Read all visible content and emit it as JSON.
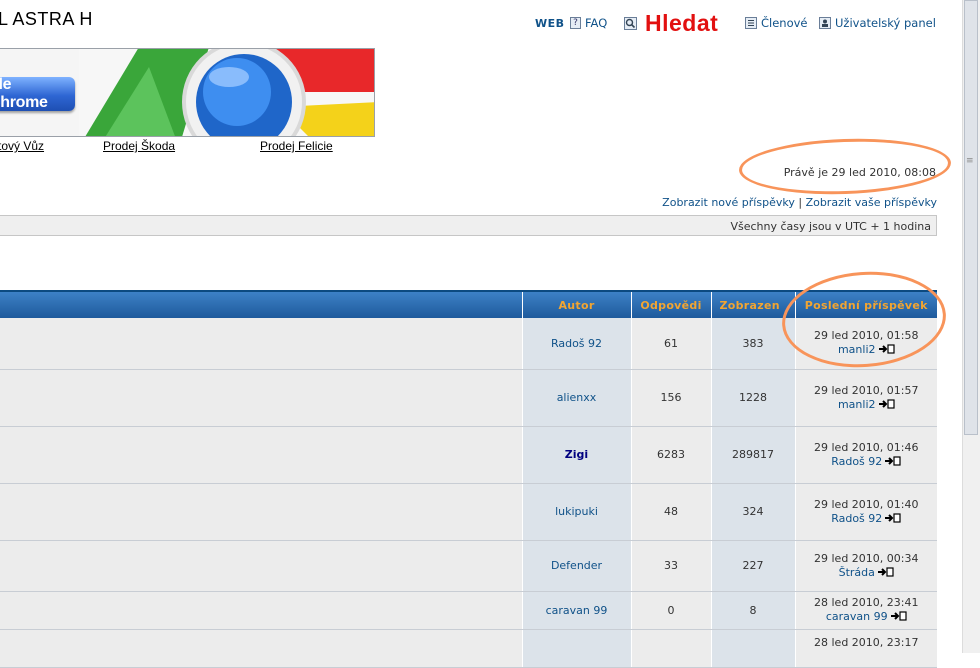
{
  "header": {
    "site_title": "L ASTRA H",
    "nav": {
      "web": "WEB",
      "faq": "FAQ",
      "search": "Hledat",
      "members": "Členové",
      "user_panel": "Uživatelský panel"
    }
  },
  "banner": {
    "button_label": "gle Chrome",
    "links": [
      "tový Vůz",
      "Prodej Škoda",
      "Prodej Felicie"
    ]
  },
  "info": {
    "current_time": "Právě je 29 led 2010, 08:08",
    "new_posts_link": "Zobrazit nové příspěvky",
    "separator": "|",
    "your_posts_link": "Zobrazit vaše příspěvky",
    "timezone": "Všechny časy jsou v UTC + 1 hodina"
  },
  "table": {
    "headers": {
      "author": "Autor",
      "replies": "Odpovědi",
      "views": "Zobrazen",
      "last_post": "Poslední příspěvek"
    },
    "rows": [
      {
        "author": "Radoš 92",
        "replies": "61",
        "views": "383",
        "last_date": "29 led 2010, 01:58",
        "last_user": "manli2"
      },
      {
        "author": "alienxx",
        "replies": "156",
        "views": "1228",
        "last_date": "29 led 2010, 01:57",
        "last_user": "manli2"
      },
      {
        "author": "Zigi",
        "replies": "6283",
        "views": "289817",
        "last_date": "29 led 2010, 01:46",
        "last_user": "Radoš 92"
      },
      {
        "author": "lukipuki",
        "replies": "48",
        "views": "324",
        "last_date": "29 led 2010, 01:40",
        "last_user": "Radoš 92"
      },
      {
        "author": "Defender",
        "replies": "33",
        "views": "227",
        "last_date": "29 led 2010, 00:34",
        "last_user": "Štráda"
      },
      {
        "author": "caravan 99",
        "replies": "0",
        "views": "8",
        "last_date": "28 led 2010, 23:41",
        "last_user": "caravan 99"
      },
      {
        "author": "",
        "replies": "",
        "views": "",
        "last_date": "28 led 2010, 23:17",
        "last_user": ""
      }
    ]
  },
  "colors": {
    "header_bg": "#1e5a9c",
    "header_text": "#f2a531",
    "link": "#105289",
    "search": "#e21010",
    "annotation": "#f8945a"
  }
}
